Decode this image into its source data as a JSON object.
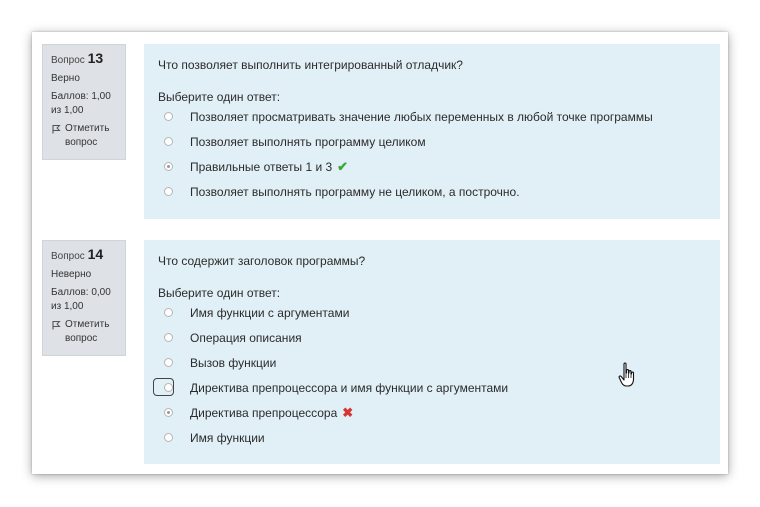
{
  "q13": {
    "prefix": "Вопрос",
    "number": "13",
    "status": "Верно",
    "score": "Баллов: 1,00 из 1,00",
    "flag_label": "Отметить вопрос",
    "text": "Что позволяет выполнить интегрированный отладчик?",
    "prompt": "Выберите один ответ:",
    "answers": [
      {
        "label": "Позволяет просматривать значение любых переменных в любой точке программы",
        "selected": false
      },
      {
        "label": "Позволяет выполнять программу целиком",
        "selected": false
      },
      {
        "label": "Правильные ответы 1 и 3",
        "selected": true,
        "mark": "✔"
      },
      {
        "label": "Позволяет выполнять программу не целиком, а построчно.",
        "selected": false
      }
    ]
  },
  "q14": {
    "prefix": "Вопрос",
    "number": "14",
    "status": "Неверно",
    "score": "Баллов: 0,00 из 1,00",
    "flag_label": "Отметить вопрос",
    "text": "Что содержит заголовок программы?",
    "prompt": "Выберите один ответ:",
    "answers": [
      {
        "label": "Имя функции с аргументами",
        "selected": false
      },
      {
        "label": "Операция описания",
        "selected": false
      },
      {
        "label": "Вызов функции",
        "selected": false
      },
      {
        "label": "Директива препроцессора и имя функции с аргументами",
        "selected": false,
        "focused": true
      },
      {
        "label": "Директива препроцессора",
        "selected": true,
        "mark": "✖"
      },
      {
        "label": "Имя функции",
        "selected": false
      }
    ]
  },
  "colors": {
    "content_bg": "#e1f0f6",
    "info_bg": "#dee2e6",
    "correct": "#3aa93a",
    "incorrect": "#d83434"
  },
  "cursor_icon": "hand-pointer-icon"
}
